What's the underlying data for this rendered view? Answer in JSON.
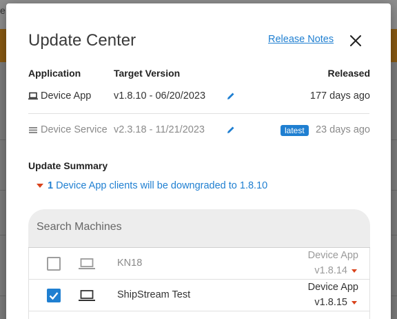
{
  "background": {
    "top_letter": "e"
  },
  "dialog": {
    "title": "Update Center",
    "release_notes_label": "Release Notes",
    "close_icon": "close-icon"
  },
  "versions_table": {
    "headers": {
      "application": "Application",
      "target_version": "Target Version",
      "released": "Released"
    },
    "rows": [
      {
        "icon": "laptop-icon",
        "application": "Device App",
        "target_version": "v1.8.10 - 06/20/2023",
        "badge": "",
        "released": "177 days ago",
        "muted": false
      },
      {
        "icon": "list-icon",
        "application": "Device Service",
        "target_version": "v2.3.18 - 11/21/2023",
        "badge": "latest",
        "released": "23 days ago",
        "muted": true
      }
    ]
  },
  "summary": {
    "title": "Update Summary",
    "count": "1",
    "text": "Device App clients will be downgraded to 1.8.10"
  },
  "search": {
    "placeholder": "Search Machines",
    "value": ""
  },
  "machines": [
    {
      "checked": false,
      "name": "KN18",
      "app": "Device App",
      "version": "v1.8.14",
      "muted": true
    },
    {
      "checked": true,
      "name": "ShipStream Test",
      "app": "Device App",
      "version": "v1.8.15",
      "muted": false
    }
  ],
  "colors": {
    "accent": "#1f7fd1",
    "warning_caret": "#d9431c",
    "header_band": "#8a5a12"
  }
}
